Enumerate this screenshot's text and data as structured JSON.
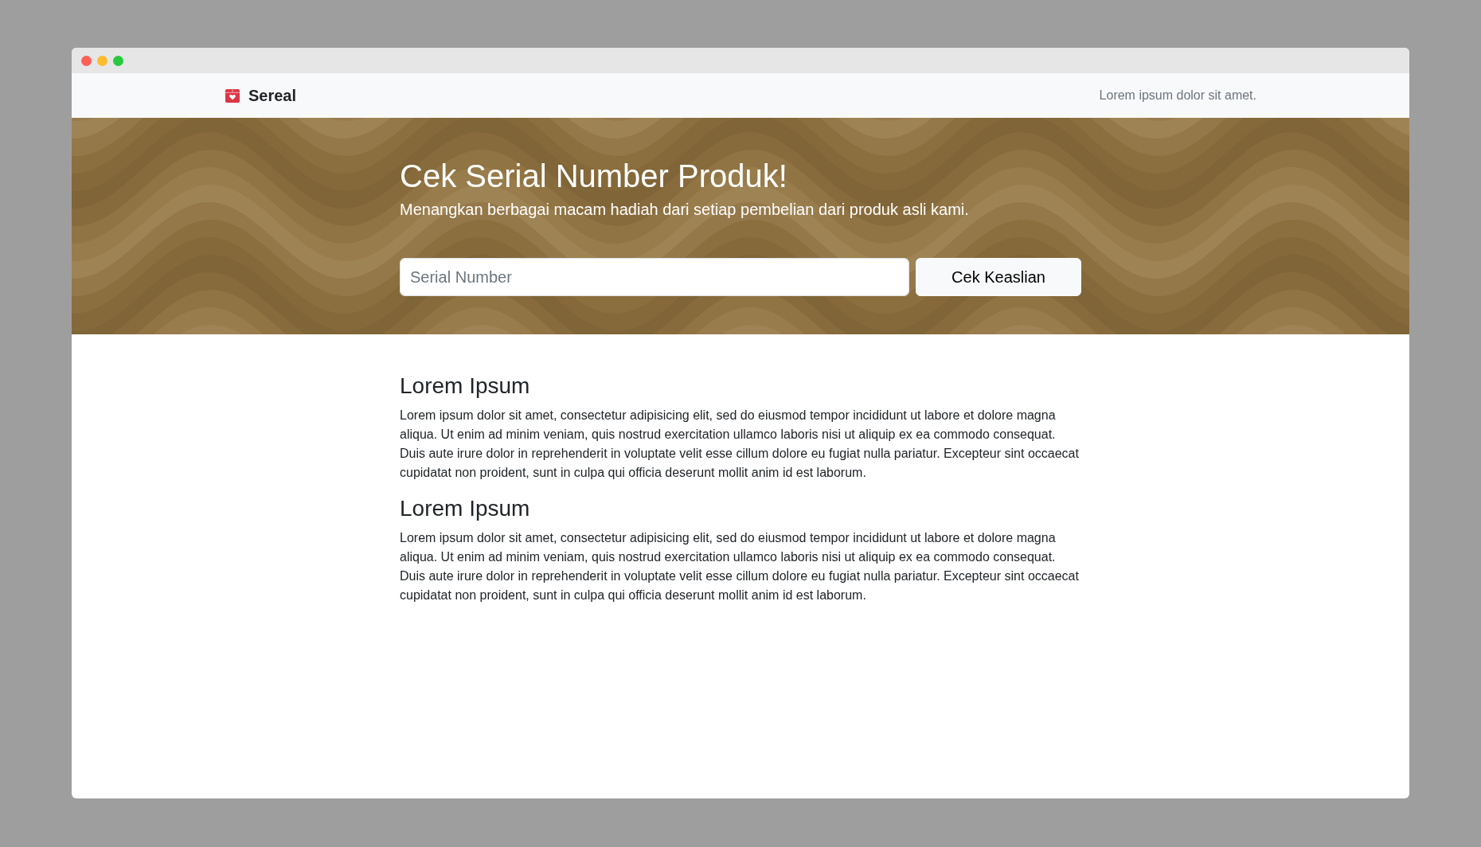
{
  "navbar": {
    "brand": "Sereal",
    "text": "Lorem ipsum dolor sit amet."
  },
  "hero": {
    "title": "Cek Serial Number Produk!",
    "subtitle": "Menangkan berbagai macam hadiah dari setiap pembelian dari produk asli kami.",
    "search": {
      "placeholder": "Serial Number"
    },
    "button": "Cek Keaslian"
  },
  "sections": [
    {
      "heading": "Lorem Ipsum",
      "text": "Lorem ipsum dolor sit amet, consectetur adipisicing elit, sed do eiusmod tempor incididunt ut labore et dolore magna aliqua. Ut enim ad minim veniam, quis nostrud exercitation ullamco laboris nisi ut aliquip ex ea commodo consequat. Duis aute irure dolor in reprehenderit in voluptate velit esse cillum dolore eu fugiat nulla pariatur. Excepteur sint occaecat cupidatat non proident, sunt in culpa qui officia deserunt mollit anim id est laborum."
    },
    {
      "heading": "Lorem Ipsum",
      "text": "Lorem ipsum dolor sit amet, consectetur adipisicing elit, sed do eiusmod tempor incididunt ut labore et dolore magna aliqua. Ut enim ad minim veniam, quis nostrud exercitation ullamco laboris nisi ut aliquip ex ea commodo consequat. Duis aute irure dolor in reprehenderit in voluptate velit esse cillum dolore eu fugiat nulla pariatur. Excepteur sint occaecat cupidatat non proident, sunt in culpa qui officia deserunt mollit anim id est laborum."
    }
  ]
}
